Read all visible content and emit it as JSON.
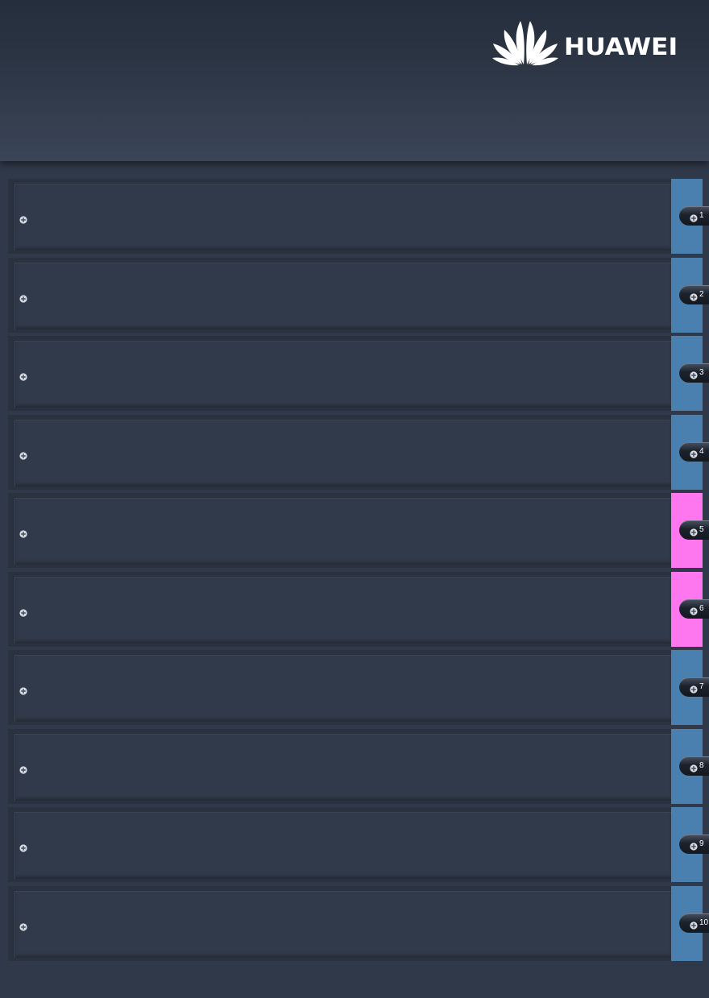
{
  "header": {
    "brand_name": "HUAWEI",
    "logo_icon": "huawei-petal-logo"
  },
  "colors": {
    "slot_default": "#4a80b0",
    "slot_highlight": "#ff77ee",
    "background": "#30394a"
  },
  "slots": [
    {
      "number": "1",
      "state": "default"
    },
    {
      "number": "2",
      "state": "default"
    },
    {
      "number": "3",
      "state": "default"
    },
    {
      "number": "4",
      "state": "default"
    },
    {
      "number": "5",
      "state": "highlight"
    },
    {
      "number": "6",
      "state": "highlight"
    },
    {
      "number": "7",
      "state": "default"
    },
    {
      "number": "8",
      "state": "default"
    },
    {
      "number": "9",
      "state": "default"
    },
    {
      "number": "10",
      "state": "default"
    }
  ]
}
